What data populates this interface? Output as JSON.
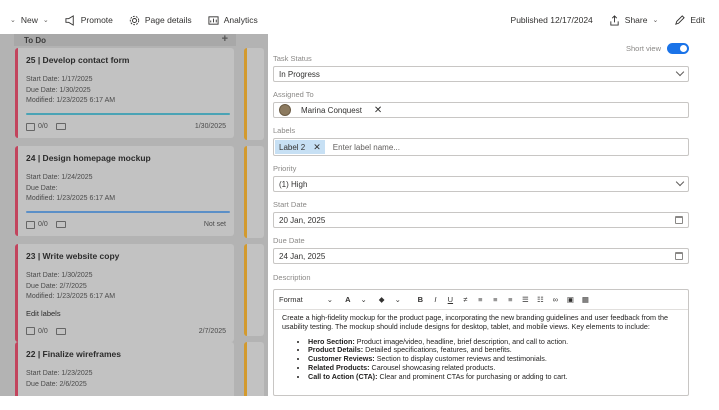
{
  "toolbar": {
    "new": "New",
    "promote": "Promote",
    "page_details": "Page details",
    "analytics": "Analytics",
    "published": "Published 12/17/2024",
    "share": "Share",
    "edit": "Edit"
  },
  "board": {
    "column_title": "To Do",
    "add": "+",
    "cards": [
      {
        "title": "25 | Develop contact form",
        "start_label": "Start Date:",
        "start": "1/17/2025",
        "due_label": "Due Date:",
        "due": "1/30/2025",
        "modified_label": "Modified:",
        "modified": "1/23/2025 6:17 AM",
        "checks": "0/0",
        "date": "1/30/2025",
        "bar_color": "#4aa3b5"
      },
      {
        "title": "24 | Design homepage mockup",
        "start_label": "Start Date:",
        "start": "1/24/2025",
        "due_label": "Due Date:",
        "due": "",
        "modified_label": "Modified:",
        "modified": "1/23/2025 6:17 AM",
        "checks": "0/0",
        "date": "Not set",
        "bar_color": "#5b8fc7"
      },
      {
        "title": "23 | Write website copy",
        "start_label": "Start Date:",
        "start": "1/30/2025",
        "due_label": "Due Date:",
        "due": "2/7/2025",
        "modified_label": "Modified:",
        "modified": "1/23/2025 6:17 AM",
        "extra": "Edit labels",
        "checks": "0/0",
        "date": "2/7/2025",
        "bar_color": ""
      },
      {
        "title": "22 | Finalize wireframes",
        "start_label": "Start Date:",
        "start": "1/23/2025",
        "due_label": "Due Date:",
        "due": "2/6/2025",
        "modified_label": "Modified:",
        "modified": "",
        "checks": "",
        "date": "",
        "bar_color": ""
      }
    ]
  },
  "panel": {
    "short_view": "Short view",
    "task_status_label": "Task Status",
    "task_status_value": "In Progress",
    "assigned_label": "Assigned To",
    "assigned_value": "Marina Conquest",
    "labels_label": "Labels",
    "label_chip": "Label 2",
    "label_placeholder": "Enter label name...",
    "priority_label": "Priority",
    "priority_value": "(1) High",
    "start_label": "Start Date",
    "start_value": "20 Jan, 2025",
    "due_label": "Due Date",
    "due_value": "24 Jan, 2025",
    "description_label": "Description",
    "editor": {
      "format": "Format",
      "font_color": "A",
      "bold": "B",
      "italic": "I",
      "underline": "U",
      "intro": "Create a high-fidelity mockup for the product page, incorporating the new branding guidelines and user feedback from the usability testing. The mockup should include designs for desktop, tablet, and mobile views. Key elements to include:",
      "items": [
        {
          "head": "Hero Section:",
          "text": "Product image/video, headline, brief description, and call to action."
        },
        {
          "head": "Product Details:",
          "text": "Detailed specifications, features, and benefits."
        },
        {
          "head": "Customer Reviews:",
          "text": "Section to display customer reviews and testimonials."
        },
        {
          "head": "Related Products:",
          "text": "Carousel showcasing related products."
        },
        {
          "head": "Call to Action (CTA):",
          "text": "Clear and prominent CTAs for purchasing or adding to cart."
        }
      ]
    }
  },
  "colors": {
    "accent": "#1a73e8",
    "chip": "#c7e0f4",
    "card_border": "#c2445d"
  }
}
